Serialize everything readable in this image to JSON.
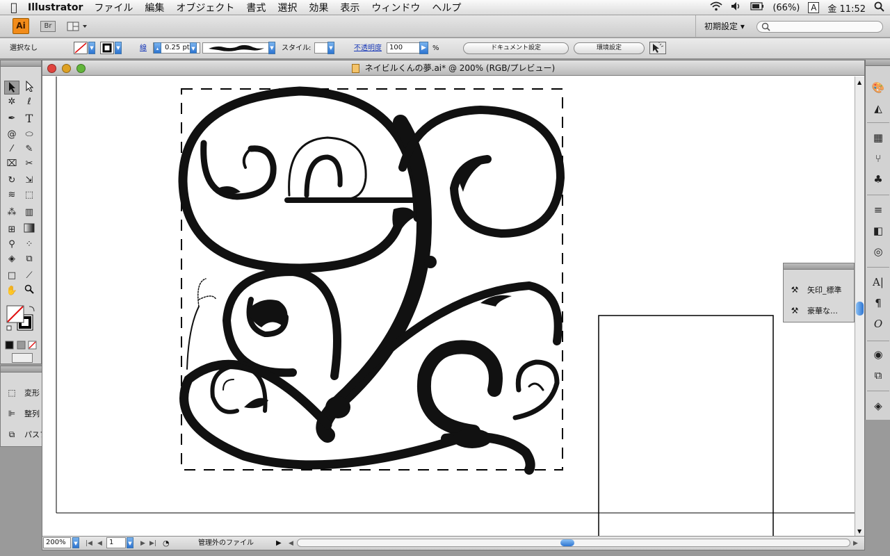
{
  "menubar": {
    "app_name": "Illustrator",
    "items": [
      "ファイル",
      "編集",
      "オブジェクト",
      "書式",
      "選択",
      "効果",
      "表示",
      "ウィンドウ",
      "ヘルプ"
    ],
    "battery": "(66%)",
    "input_method": "A",
    "clock": "金 11:52"
  },
  "apptoolbar": {
    "logo": "Ai",
    "bridge": "Br",
    "workspace_preset": "初期設定 ▾"
  },
  "controlbar": {
    "selection": "選択なし",
    "stroke_label": "線",
    "stroke_weight": "0.25 pt",
    "style_label": "スタイル",
    "opacity_label": "不透明度",
    "opacity_value": "100",
    "opacity_unit": "%",
    "document_setup": "ドキュメント設定",
    "preferences": "環境設定"
  },
  "document": {
    "title": "ネイビルくんの夢.ai* @ 200% (RGB/プレビュー)"
  },
  "status": {
    "zoom": "200%",
    "artboard": "1",
    "file_status": "管理外のファイル"
  },
  "left_panel": {
    "items": [
      {
        "label": "変形",
        "icon": "transform-icon"
      },
      {
        "label": "整列",
        "icon": "align-icon"
      },
      {
        "label": "パスファインダ",
        "icon": "pathfinder-icon"
      }
    ]
  },
  "float_panel": {
    "items": [
      {
        "label": "矢印_標準",
        "icon": "brush-library-icon"
      },
      {
        "label": "豪華な…",
        "icon": "brush-library-icon"
      }
    ]
  },
  "colors": {
    "accent_blue": "#2d74d1",
    "ai_orange": "#f28c1a"
  }
}
